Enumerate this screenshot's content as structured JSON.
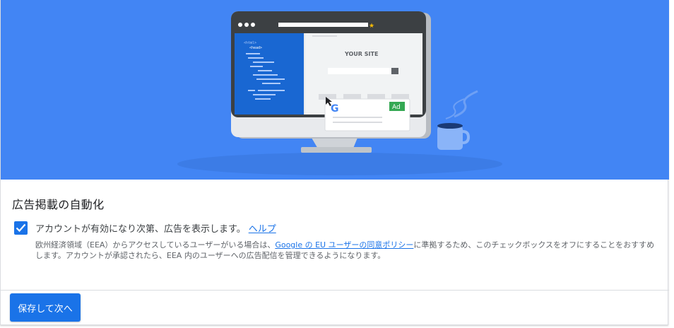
{
  "hero": {
    "site_label": "YOUR SITE",
    "code_lines": [
      "<html>",
      "<head>"
    ],
    "ad_badge": "Ad",
    "google_logo": "google-g-logo",
    "colors": {
      "background": "#4285f4",
      "monitor_frame": "#3c4043",
      "code_panel": "#1967d2",
      "ad_badge": "#34a853"
    }
  },
  "section": {
    "title": "広告掲載の自動化"
  },
  "consent": {
    "checked": true,
    "label": "アカウントが有効になり次第、広告を表示します。",
    "help_link": "ヘルプ",
    "note_before": "欧州経済領域（EEA）からアクセスしているユーザーがいる場合は、",
    "note_link": "Google の EU ユーザーの同意ポリシー",
    "note_after": "に準拠するため、このチェックボックスをオフにすることをおすすめします。アカウントが承認されたら、EEA 内のユーザーへの広告配信を管理できるようになります。"
  },
  "footer": {
    "save_label": "保存して次へ"
  }
}
